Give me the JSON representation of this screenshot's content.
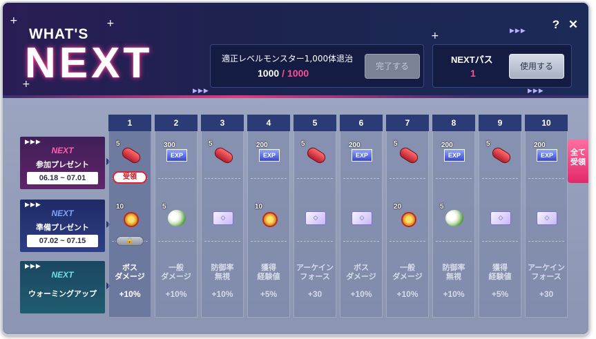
{
  "header": {
    "logo_top": "WHAT'S",
    "logo_main": "NEXT",
    "mission": {
      "label": "適正レベルモンスター1,000体退治",
      "current": "1000",
      "separator": "/",
      "total": "1000",
      "complete_label": "完了する"
    },
    "pass": {
      "label": "NEXTパス",
      "count": "1",
      "use_label": "使用する"
    },
    "help_label": "?",
    "close_label": "✕"
  },
  "rows": [
    {
      "next": "NEXT",
      "title": "参加プレゼント",
      "date": "06.18 ~ 07.01"
    },
    {
      "next": "NEXT",
      "title": "準備プレゼント",
      "date": "07.02 ~ 07.15"
    },
    {
      "next": "NEXT",
      "title": "ウォーミングアップ"
    }
  ],
  "columns": [
    {
      "num": "1",
      "r1": {
        "type": "capsule",
        "qty": "5"
      },
      "r2": {
        "type": "medal",
        "qty": "10"
      },
      "stat": "ボス\nダメージ",
      "val": "+10%"
    },
    {
      "num": "2",
      "r1": {
        "type": "exp",
        "qty": "300",
        "label": "EXP"
      },
      "r2": {
        "type": "flower",
        "qty": "5"
      },
      "stat": "一般\nダメージ",
      "val": "+10%"
    },
    {
      "num": "3",
      "r1": {
        "type": "capsule",
        "qty": "5"
      },
      "r2": {
        "type": "card"
      },
      "stat": "防御率\n無視",
      "val": "+10%"
    },
    {
      "num": "4",
      "r1": {
        "type": "exp",
        "qty": "200",
        "label": "EXP"
      },
      "r2": {
        "type": "medal",
        "qty": "10"
      },
      "stat": "獲得\n経験値",
      "val": "+5%"
    },
    {
      "num": "5",
      "r1": {
        "type": "capsule",
        "qty": "5"
      },
      "r2": {
        "type": "card"
      },
      "stat": "アーケイン\nフォース",
      "val": "+30"
    },
    {
      "num": "6",
      "r1": {
        "type": "exp",
        "qty": "200",
        "label": "EXP"
      },
      "r2": {
        "type": "card"
      },
      "stat": "ボス\nダメージ",
      "val": "+10%"
    },
    {
      "num": "7",
      "r1": {
        "type": "capsule",
        "qty": "5"
      },
      "r2": {
        "type": "medal",
        "qty": "20"
      },
      "stat": "一般\nダメージ",
      "val": "+10%"
    },
    {
      "num": "8",
      "r1": {
        "type": "exp",
        "qty": "200",
        "label": "EXP"
      },
      "r2": {
        "type": "flower",
        "qty": "5"
      },
      "stat": "防御率\n無視",
      "val": "+10%"
    },
    {
      "num": "9",
      "r1": {
        "type": "capsule",
        "qty": "5"
      },
      "r2": {
        "type": "card"
      },
      "stat": "獲得\n経験値",
      "val": "+5%"
    },
    {
      "num": "10",
      "r1": {
        "type": "exp",
        "qty": "200",
        "label": "EXP"
      },
      "r2": {
        "type": "card"
      },
      "stat": "アーケイン\nフォース",
      "val": "+30"
    }
  ],
  "received_label": "受領",
  "lock_icon": "🔒",
  "claim_all_label": "全て\n受領"
}
